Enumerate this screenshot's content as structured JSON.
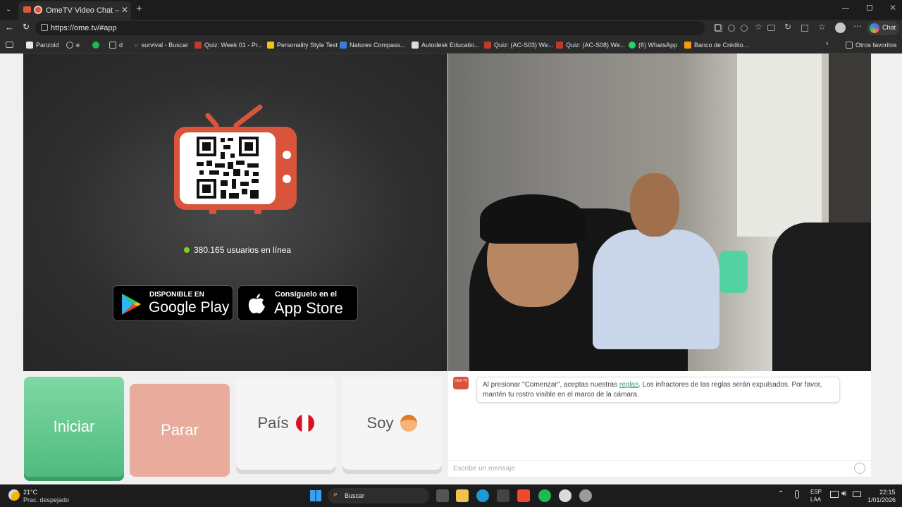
{
  "browser": {
    "tab_title": "OmeTV Video Chat — Omegl",
    "url": "https://ome.tv/#app",
    "copilot_label": "Chat",
    "bookmarks": [
      {
        "label": "Panzoid",
        "color": "#e8e8e8"
      },
      {
        "label": "e",
        "color": "#bbbbbb"
      },
      {
        "label": "",
        "color": "#1db954"
      },
      {
        "label": "d",
        "color": "#bbbbbb"
      },
      {
        "label": "survival - Buscar",
        "color": "#4a90e2"
      },
      {
        "label": "Quiz: Week 01 - Pr...",
        "color": "#c0392b"
      },
      {
        "label": "Personality Style Test",
        "color": "#f1c40f"
      },
      {
        "label": "Natures Compass...",
        "color": "#3b7dd8"
      },
      {
        "label": "Autodesk Educatio...",
        "color": "#dddddd"
      },
      {
        "label": "Quiz: (AC-S03) We...",
        "color": "#c0392b"
      },
      {
        "label": "Quiz: (AC-S08) We...",
        "color": "#c0392b"
      },
      {
        "label": "(6) WhatsApp",
        "color": "#25d366"
      },
      {
        "label": "Banco de Crédito...",
        "color": "#f39c12"
      }
    ],
    "other_favorites": "Otros favoritos"
  },
  "app": {
    "online_count_text": "380.165 usuarios en línea",
    "google_play_small": "DISPONIBLE EN",
    "google_play_big": "Google Play",
    "app_store_small": "Consíguelo en el",
    "app_store_big": "App Store",
    "start_label": "Iniciar",
    "stop_label": "Parar",
    "country_label": "País",
    "gender_label": "Soy",
    "chat_message_before": "Al presionar \"Comenzar\", aceptas nuestras ",
    "chat_rules_link": "reglas",
    "chat_message_after": ". Los infractores de las reglas serán expulsados. Por favor, mantén tu rostro visible en el marco de la cámara.",
    "chat_logo_text": "Ome TV",
    "chat_input_placeholder": "Escribe un mensaje",
    "colors": {
      "start": "#5cc48a",
      "stop": "#e8a898",
      "tv_orange": "#d9543a",
      "online_dot": "#7ed321"
    }
  },
  "taskbar": {
    "weather_temp": "21°C",
    "weather_desc": "Prac. despejado",
    "search_label": "Buscar",
    "lang_1": "ESP",
    "lang_2": "LAA",
    "time": "22:15",
    "date": "1/01/2026"
  }
}
